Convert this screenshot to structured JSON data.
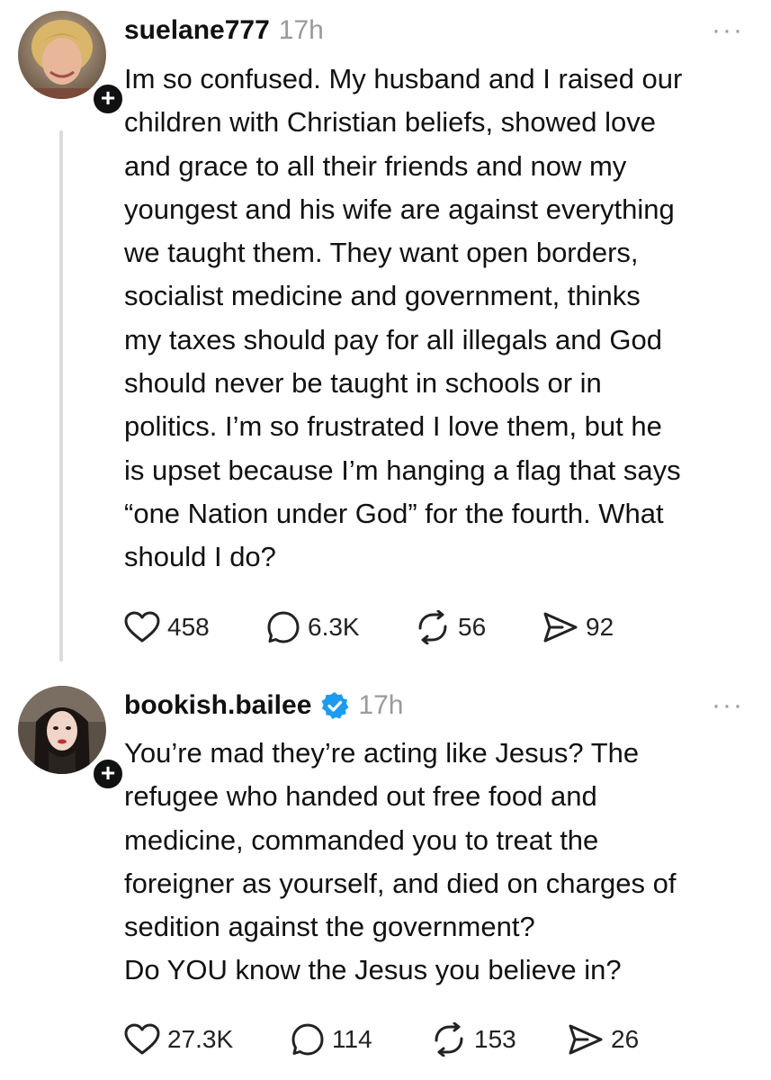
{
  "posts": [
    {
      "username": "suelane777",
      "time": "17h",
      "verified": false,
      "more_label": "···",
      "follow_label": "+",
      "text": "Im so confused. My husband and I raised our\nchildren with Christian beliefs, showed love\nand grace to all their friends and now my\nyoungest and his wife are against everything\nwe taught them. They want open borders,\nsocialist medicine and government, thinks\nmy taxes should pay for all illegals and God\nshould never be taught in schools or in\npolitics.  I’m so frustrated  I love them, but he\nis upset because I’m hanging a flag that says\n“one Nation under God” for the fourth. What\nshould I do?",
      "likes": "458",
      "replies": "6.3K",
      "reposts": "56",
      "shares": "92"
    },
    {
      "username": "bookish.bailee",
      "time": "17h",
      "verified": true,
      "more_label": "···",
      "follow_label": "+",
      "text": "You’re mad they’re acting like Jesus? The\nrefugee who handed out free food and\nmedicine, commanded you to treat the\nforeigner as yourself, and died on charges of\nsedition against the government?\nDo YOU know the Jesus you believe in?",
      "likes": "27.3K",
      "replies": "114",
      "reposts": "153",
      "shares": "26"
    }
  ],
  "colors": {
    "text": "#111111",
    "muted": "#9a9a9a",
    "verified": "#1d9bf0",
    "thread_line": "#dcdcdc"
  },
  "icons": {
    "like": "heart-icon",
    "reply": "speech-bubble-icon",
    "repost": "repost-icon",
    "share": "send-icon",
    "verified": "verified-badge-icon",
    "more": "more-dots-icon"
  }
}
